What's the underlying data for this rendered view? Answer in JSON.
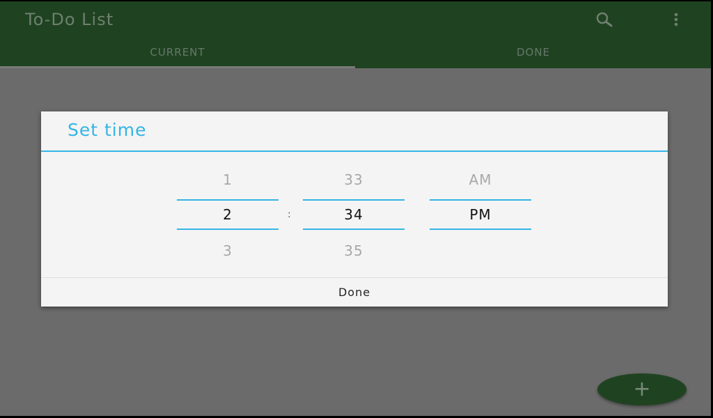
{
  "app_bar": {
    "title": "To-Do List",
    "actions": [
      "search-icon",
      "overflow-menu-icon"
    ]
  },
  "tabs": [
    {
      "label": "CURRENT",
      "selected": true
    },
    {
      "label": "DONE",
      "selected": false
    }
  ],
  "dialog": {
    "title": "Set time",
    "separator": ":",
    "hour": {
      "prev": "1",
      "selected": "2",
      "next": "3"
    },
    "minute": {
      "prev": "33",
      "selected": "34",
      "next": "35"
    },
    "ampm": {
      "prev": "AM",
      "selected": "PM",
      "next": ""
    },
    "done_label": "Done"
  },
  "fab": {
    "icon": "plus-icon",
    "label": "+"
  },
  "colors": {
    "primary": "#1f4321",
    "accent": "#33b5e5",
    "scrim": "#6b6b6b"
  }
}
